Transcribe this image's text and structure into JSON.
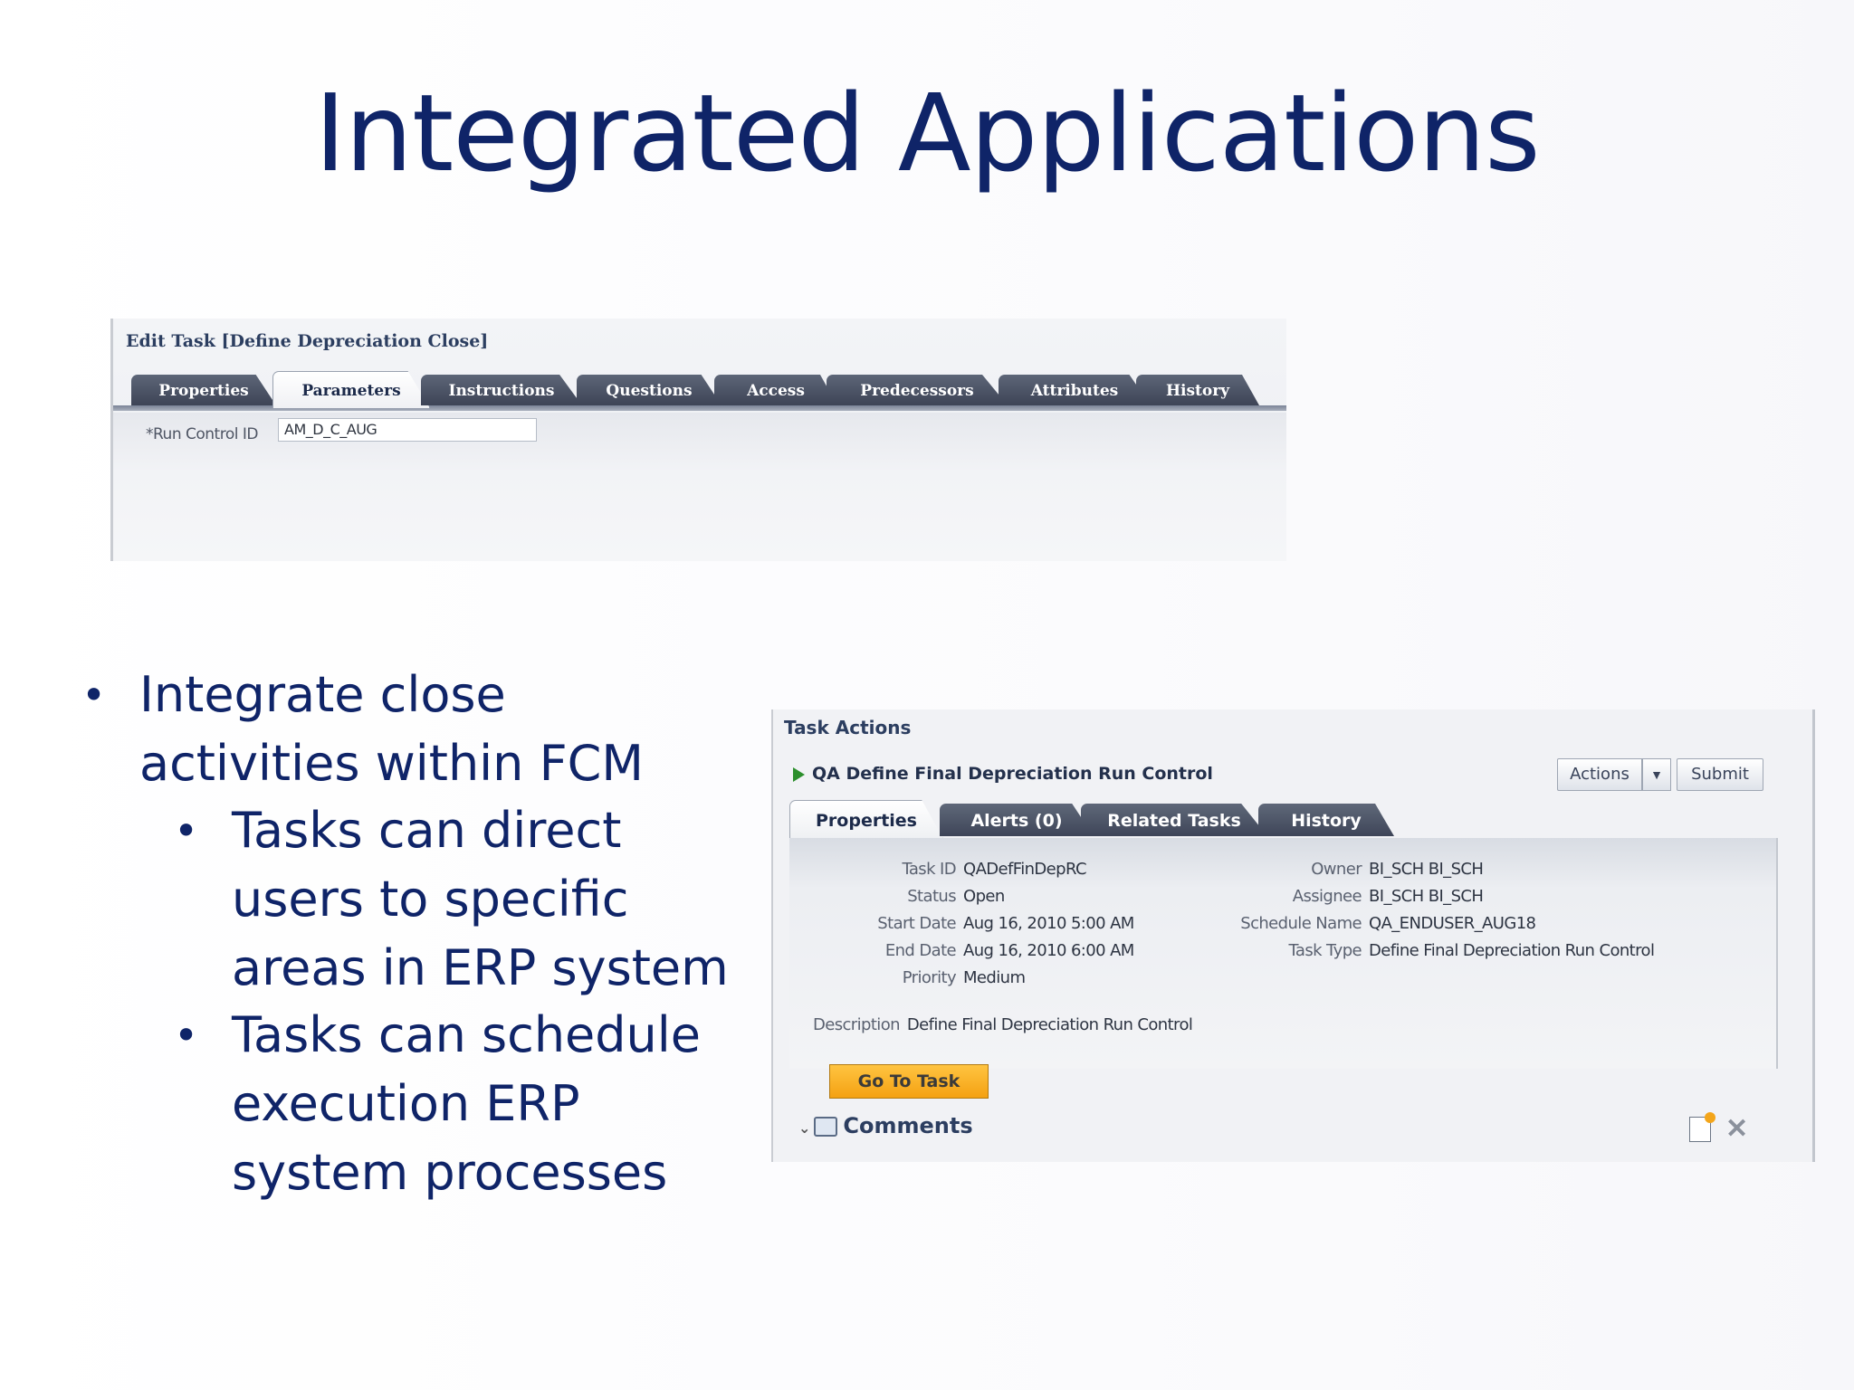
{
  "slide": {
    "title": "Integrated Applications",
    "bullets": [
      {
        "text": "Integrate close activities within FCM",
        "level": 1
      },
      {
        "text": "Tasks can direct users to specific areas in ERP system",
        "level": 2
      },
      {
        "text": "Tasks can schedule execution ERP system processes",
        "level": 2
      }
    ]
  },
  "edit_task": {
    "title": "Edit Task [Define Depreciation Close]",
    "tabs": [
      "Properties",
      "Parameters",
      "Instructions",
      "Questions",
      "Access",
      "Predecessors",
      "Attributes",
      "History"
    ],
    "active_tab": "Parameters",
    "run_control_label": "*Run Control ID",
    "run_control_value": "AM_D_C_AUG"
  },
  "task_actions": {
    "title": "Task Actions",
    "task_name": "QA Define Final Depreciation Run Control",
    "actions_label": "Actions",
    "submit_label": "Submit",
    "tabs": [
      "Properties",
      "Alerts (0)",
      "Related Tasks",
      "History"
    ],
    "active_tab": "Properties",
    "fields_left": [
      {
        "label": "Task ID",
        "value": "QADefFinDepRC"
      },
      {
        "label": "Status",
        "value": "Open"
      },
      {
        "label": "Start Date",
        "value": "Aug 16, 2010 5:00 AM"
      },
      {
        "label": "End Date",
        "value": "Aug 16, 2010 6:00 AM"
      },
      {
        "label": "Priority",
        "value": "Medium"
      }
    ],
    "fields_right": [
      {
        "label": "Owner",
        "value": "BI_SCH BI_SCH"
      },
      {
        "label": "Assignee",
        "value": "BI_SCH BI_SCH"
      },
      {
        "label": "Schedule Name",
        "value": "QA_ENDUSER_AUG18"
      },
      {
        "label": "Task Type",
        "value": "Define Final Depreciation Run Control"
      }
    ],
    "description_label": "Description",
    "description_value": "Define Final Depreciation Run Control",
    "go_to_task_label": "Go To Task",
    "comments_label": "Comments"
  },
  "colors": {
    "title_blue": "#0f2468",
    "tab_dark": "#3e4558",
    "go_button_orange": "#f4a112"
  }
}
